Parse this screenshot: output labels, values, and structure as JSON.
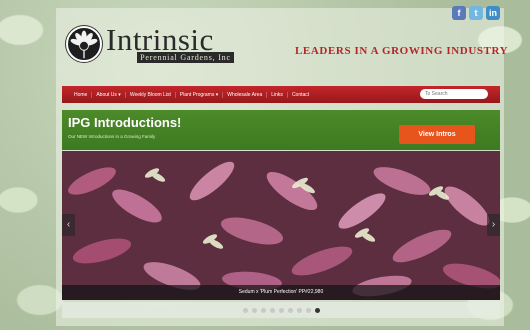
{
  "social": {
    "icons": [
      "facebook-icon",
      "twitter-icon",
      "linkedin-icon"
    ]
  },
  "header": {
    "logo_name": "Intrinsic",
    "logo_sub": "Perennial Gardens, Inc",
    "tagline": "LEADERS IN A GROWING INDUSTRY"
  },
  "nav": {
    "items": [
      "Home",
      "About Us ▾",
      "Weekly Bloom List",
      "Plant Programs ▾",
      "Wholesale Area",
      "Links",
      "Contact"
    ],
    "search_placeholder": "To Search"
  },
  "intro": {
    "title": "IPG Introductions!",
    "subtitle": "Our NEW Introductions in a Growing Family",
    "button": "View Intros"
  },
  "slider": {
    "caption": "Sedum x 'Plum Perfection' PP#22,980",
    "prev_arrow": "‹",
    "next_arrow": "›",
    "dots": 9,
    "active_dot": 8
  },
  "colors": {
    "nav_red": "#b3262a",
    "intro_green": "#4c8a2a",
    "button_orange": "#e8551c"
  }
}
